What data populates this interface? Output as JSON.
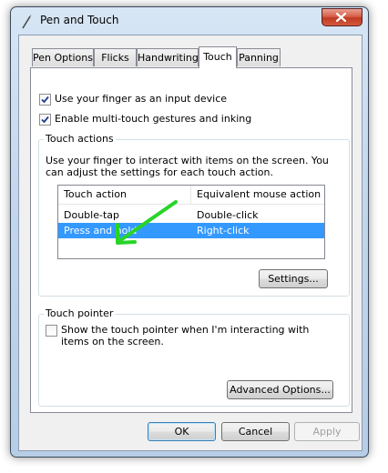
{
  "window": {
    "title": "Pen and Touch"
  },
  "tabs": [
    {
      "label": "Pen Options",
      "active": false
    },
    {
      "label": "Flicks",
      "active": false
    },
    {
      "label": "Handwriting",
      "active": false
    },
    {
      "label": "Touch",
      "active": true
    },
    {
      "label": "Panning",
      "active": false
    }
  ],
  "options": {
    "use_finger": {
      "label": "Use your finger as an input device",
      "checked": true
    },
    "multitouch": {
      "label": "Enable multi-touch gestures and inking",
      "checked": true
    }
  },
  "touch_actions": {
    "group_label": "Touch actions",
    "description": "Use your finger to interact with items on the screen. You can adjust the settings for each touch action.",
    "columns": [
      "Touch action",
      "Equivalent mouse action"
    ],
    "rows": [
      {
        "action": "Double-tap",
        "mouse": "Double-click",
        "selected": false
      },
      {
        "action": "Press and hold",
        "mouse": "Right-click",
        "selected": true
      }
    ],
    "settings_button": "Settings..."
  },
  "touch_pointer": {
    "group_label": "Touch pointer",
    "show_pointer": {
      "label": "Show the touch pointer when I'm interacting with items on the screen.",
      "checked": false
    },
    "advanced_button": "Advanced Options..."
  },
  "footer": {
    "ok": "OK",
    "cancel": "Cancel",
    "apply": "Apply"
  },
  "colors": {
    "selection": "#3399ff",
    "arrow": "#27d427",
    "close_button": "#c03a22"
  }
}
